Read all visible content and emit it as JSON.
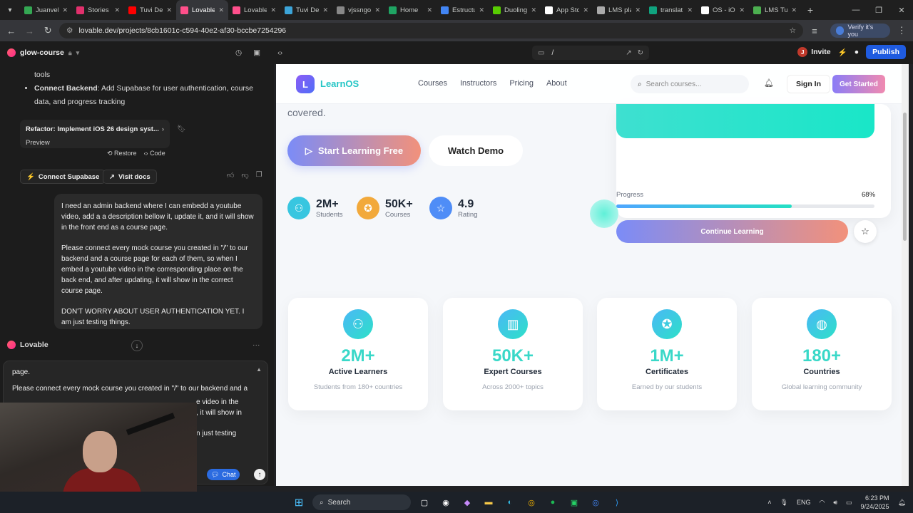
{
  "browser": {
    "tabs": [
      {
        "title": "Juanvel",
        "color": "#34a853"
      },
      {
        "title": "Stories",
        "color": "#e1306c"
      },
      {
        "title": "Tuvi Dev",
        "color": "#ff0000"
      },
      {
        "title": "Lovable",
        "color": "#ff4f8b",
        "active": true
      },
      {
        "title": "Lovable",
        "color": "#ff4f8b"
      },
      {
        "title": "Tuvi Dev",
        "color": "#3ca4d8"
      },
      {
        "title": "vjssngo",
        "color": "#888888"
      },
      {
        "title": "Home",
        "color": "#1fa463"
      },
      {
        "title": "Estructu",
        "color": "#4285f4"
      },
      {
        "title": "Duolingo",
        "color": "#58cc02"
      },
      {
        "title": "App Sto",
        "color": "#ffffff"
      },
      {
        "title": "LMS pla",
        "color": "#aaaaaa"
      },
      {
        "title": "translat",
        "color": "#10a37f"
      },
      {
        "title": "OS - iO",
        "color": "#ffffff"
      },
      {
        "title": "LMS Tu",
        "color": "#4caf50"
      }
    ],
    "url": "lovable.dev/projects/8cb1601c-c594-40e2-af30-bccbe7254296",
    "verify_label": "Verify it's you"
  },
  "lovable": {
    "project_name": "glow-course",
    "url_path": "/",
    "invite_label": "Invite",
    "avatar_letter": "J",
    "publish_label": "Publish"
  },
  "chat": {
    "bullet_partial": "tools",
    "bullet_title": "Connect Backend",
    "bullet_text": ": Add Supabase for user authentication, course data, and progress tracking",
    "refactor_title": "Refactor: Implement iOS 26 design syst...",
    "preview_label": "Preview",
    "restore_label": "Restore",
    "code_label": "Code",
    "connect_supabase_label": "Connect Supabase",
    "visit_docs_label": "Visit docs",
    "message_p1": "I need an admin backend where I can embedd a youtube video, add a a description bellow it, update it, and it will show in the front end as a course page.",
    "message_p2": "Please connect every mock course you created in \"/\" to our backend and a course page for each of them, so when I embed a youtube video in the corresponding place on the back end, and after updating, it will show in the correct course page.",
    "message_p3": "DON'T WORRY ABOUT USER AUTHENTICATION YET. I am just testing things.",
    "sender_name": "Lovable",
    "composer_p1": "page.",
    "composer_p2": "Please connect every mock course you created in \"/\" to our backend and a",
    "composer_p3_frag1": "e video in the",
    "composer_p3_frag2": ", it will show in",
    "composer_p3_frag3": "n just testing",
    "chat_label": "Chat"
  },
  "site": {
    "brand_letter": "L",
    "brand_name": "LearnOS",
    "nav": [
      "Courses",
      "Instructors",
      "Pricing",
      "About"
    ],
    "search_placeholder": "Search courses...",
    "signin_label": "Sign In",
    "get_started_label": "Get Started",
    "hero_tail": "covered.",
    "start_label": "Start Learning Free",
    "demo_label": "Watch Demo",
    "stats": [
      {
        "value": "2M+",
        "label": "Students",
        "color": "#38c6e0"
      },
      {
        "value": "50K+",
        "label": "Courses",
        "color": "#f2a93b"
      },
      {
        "value": "4.9",
        "label": "Rating",
        "color": "#4f8df7"
      }
    ],
    "progress_label": "Progress",
    "progress_value": "68%",
    "progress_fraction": 0.68,
    "continue_label": "Continue Learning",
    "features": [
      {
        "value": "2M+",
        "title": "Active Learners",
        "subtitle": "Students from 180+ countries",
        "icon": "users-icon"
      },
      {
        "value": "50K+",
        "title": "Expert Courses",
        "subtitle": "Across 2000+ topics",
        "icon": "book-icon"
      },
      {
        "value": "1M+",
        "title": "Certificates",
        "subtitle": "Earned by our students",
        "icon": "award-icon"
      },
      {
        "value": "180+",
        "title": "Countries",
        "subtitle": "Global learning community",
        "icon": "globe-icon"
      }
    ]
  },
  "taskbar": {
    "search_label": "Search",
    "lang": "ENG",
    "time": "6:23 PM",
    "date": "9/24/2025"
  }
}
